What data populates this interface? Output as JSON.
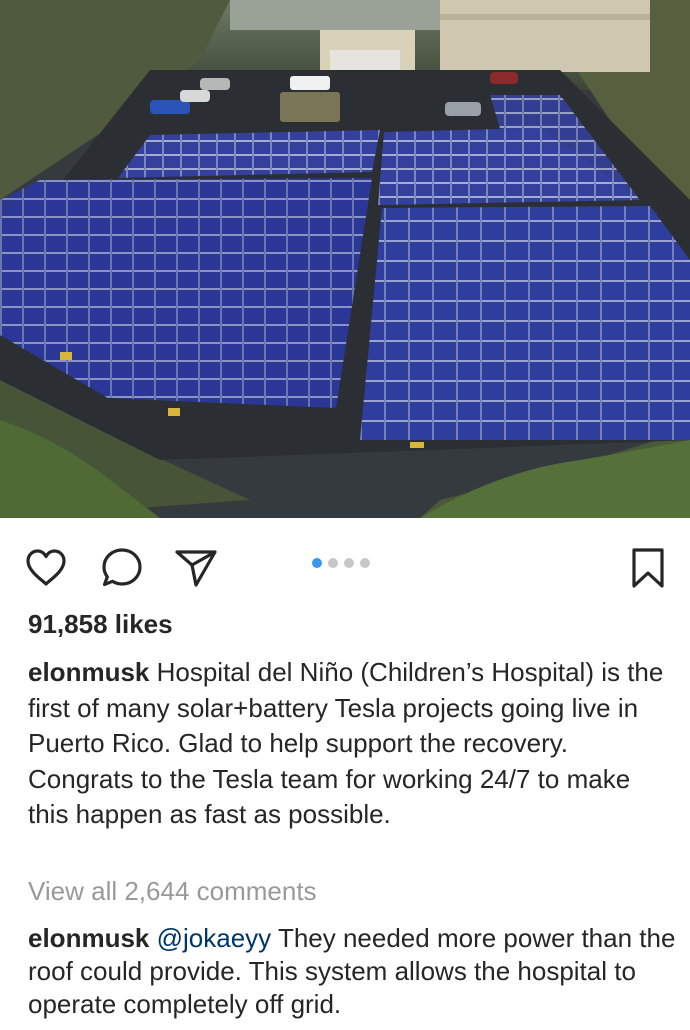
{
  "post": {
    "likes": "91,858 likes",
    "caption": {
      "username": "elonmusk",
      "text": "Hospital del Niño (Children’s Hospital) is the first of many solar+battery Tesla projects going live in Puerto Rico. Glad to help support the recovery. Congrats to the Tesla team for working 24/7 to make this happen as fast as possible."
    },
    "view_comments": "View all 2,644 comments",
    "comment": {
      "username": "elonmusk",
      "mention": "@jokaeyy",
      "text": "They needed more power than the roof could provide. This system allows the hospital to operate completely off grid."
    },
    "carousel": {
      "count": 4,
      "active_index": 0
    }
  },
  "icons": {
    "like": "heart-icon",
    "comment": "comment-bubble-icon",
    "share": "paper-plane-icon",
    "save": "bookmark-icon"
  },
  "colors": {
    "text": "#262626",
    "muted": "#999999",
    "accent_dot": "#3897f0",
    "inactive_dot": "#c7c7c7",
    "panel_blue": "#2d3a9c"
  }
}
